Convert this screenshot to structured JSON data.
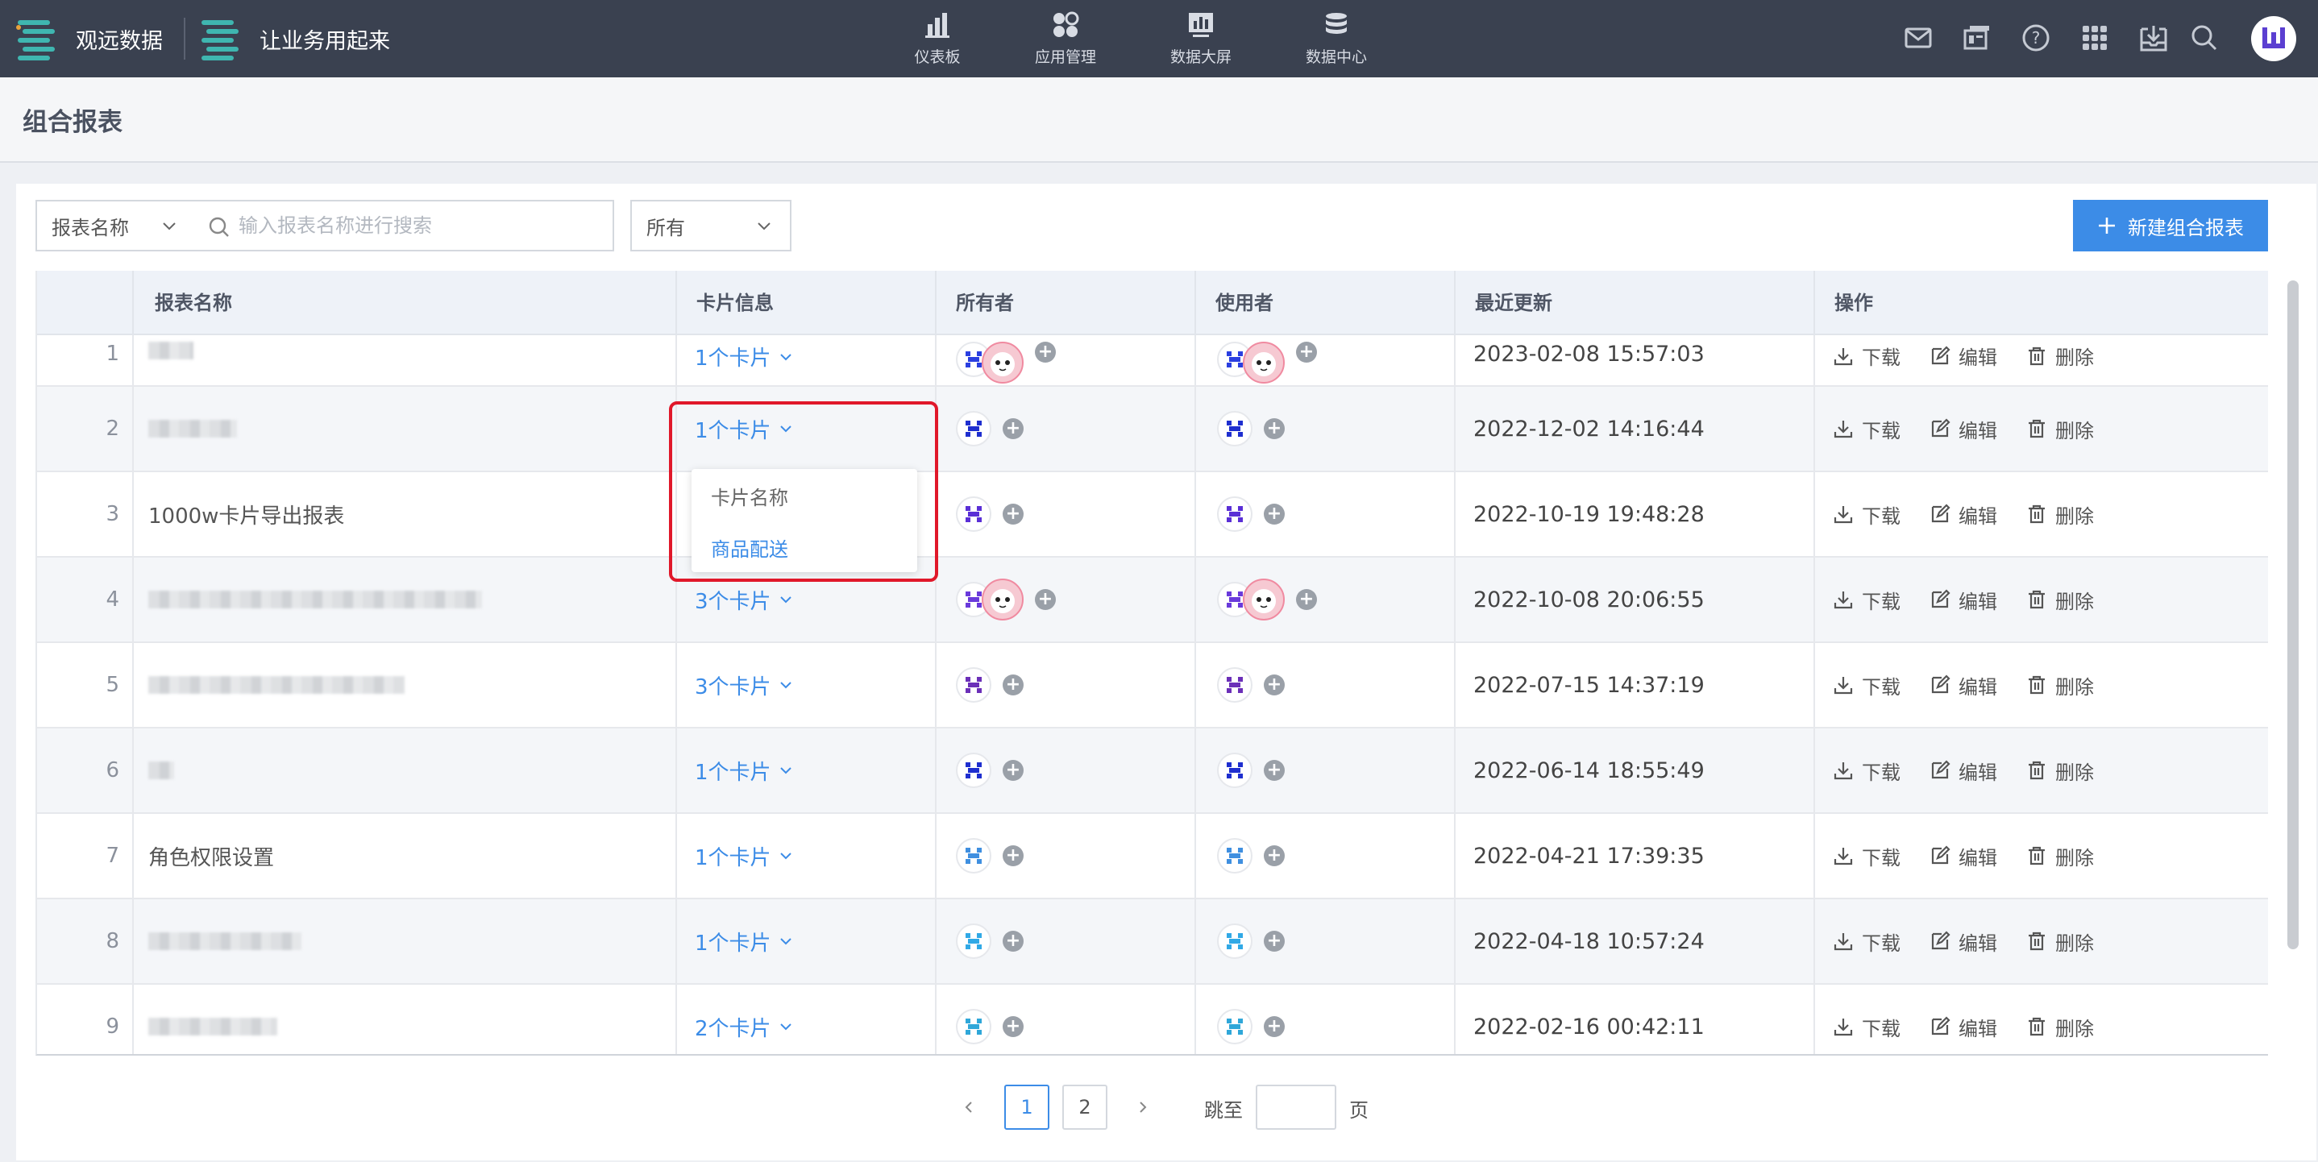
{
  "topbar": {
    "brand_primary": "观远数据",
    "brand_secondary": "让业务用起来",
    "nav": [
      {
        "label": "仪表板",
        "icon": "bar-chart-icon"
      },
      {
        "label": "应用管理",
        "icon": "apps-cluster-icon"
      },
      {
        "label": "数据大屏",
        "icon": "monitor-chart-icon"
      },
      {
        "label": "数据中心",
        "icon": "database-icon"
      }
    ],
    "right_icons": [
      "mail-icon",
      "announcement-icon",
      "help-icon",
      "grid-icon",
      "download-tray-icon",
      "search-icon",
      "user-avatar"
    ]
  },
  "page": {
    "title": "组合报表"
  },
  "toolbar": {
    "field_select": "报表名称",
    "search_placeholder": "输入报表名称进行搜索",
    "scope_select": "所有",
    "new_button": "新建组合报表"
  },
  "table": {
    "columns": [
      "报表名称",
      "卡片信息",
      "所有者",
      "使用者",
      "最近更新",
      "操作"
    ],
    "actions": {
      "download": "下载",
      "edit": "编辑",
      "delete": "删除"
    },
    "rows": [
      {
        "index": "1",
        "name": "",
        "cards": "1个卡片",
        "updated": "2023-02-08 15:57:03"
      },
      {
        "index": "2",
        "name": "",
        "cards": "1个卡片",
        "updated": "2022-12-02 14:16:44"
      },
      {
        "index": "3",
        "name": "1000w卡片导出报表",
        "cards": "",
        "updated": "2022-10-19 19:48:28"
      },
      {
        "index": "4",
        "name": "",
        "cards": "3个卡片",
        "updated": "2022-10-08 20:06:55"
      },
      {
        "index": "5",
        "name": "",
        "cards": "3个卡片",
        "updated": "2022-07-15 14:37:19"
      },
      {
        "index": "6",
        "name": "",
        "cards": "1个卡片",
        "updated": "2022-06-14 18:55:49"
      },
      {
        "index": "7",
        "name": "角色权限设置",
        "cards": "1个卡片",
        "updated": "2022-04-21 17:39:35"
      },
      {
        "index": "8",
        "name": "",
        "cards": "1个卡片",
        "updated": "2022-04-18 10:57:24"
      },
      {
        "index": "9",
        "name": "",
        "cards": "2个卡片",
        "updated": "2022-02-16 00:42:11"
      }
    ]
  },
  "card_dropdown": {
    "header": "卡片名称",
    "item": "商品配送"
  },
  "pagination": {
    "pages": [
      "1",
      "2"
    ],
    "current": "1",
    "goto_label": "跳至",
    "page_suffix": "页"
  },
  "colors": {
    "topbar": "#3a4150",
    "accent": "#3c8ce7",
    "highlight": "#e0182a"
  }
}
